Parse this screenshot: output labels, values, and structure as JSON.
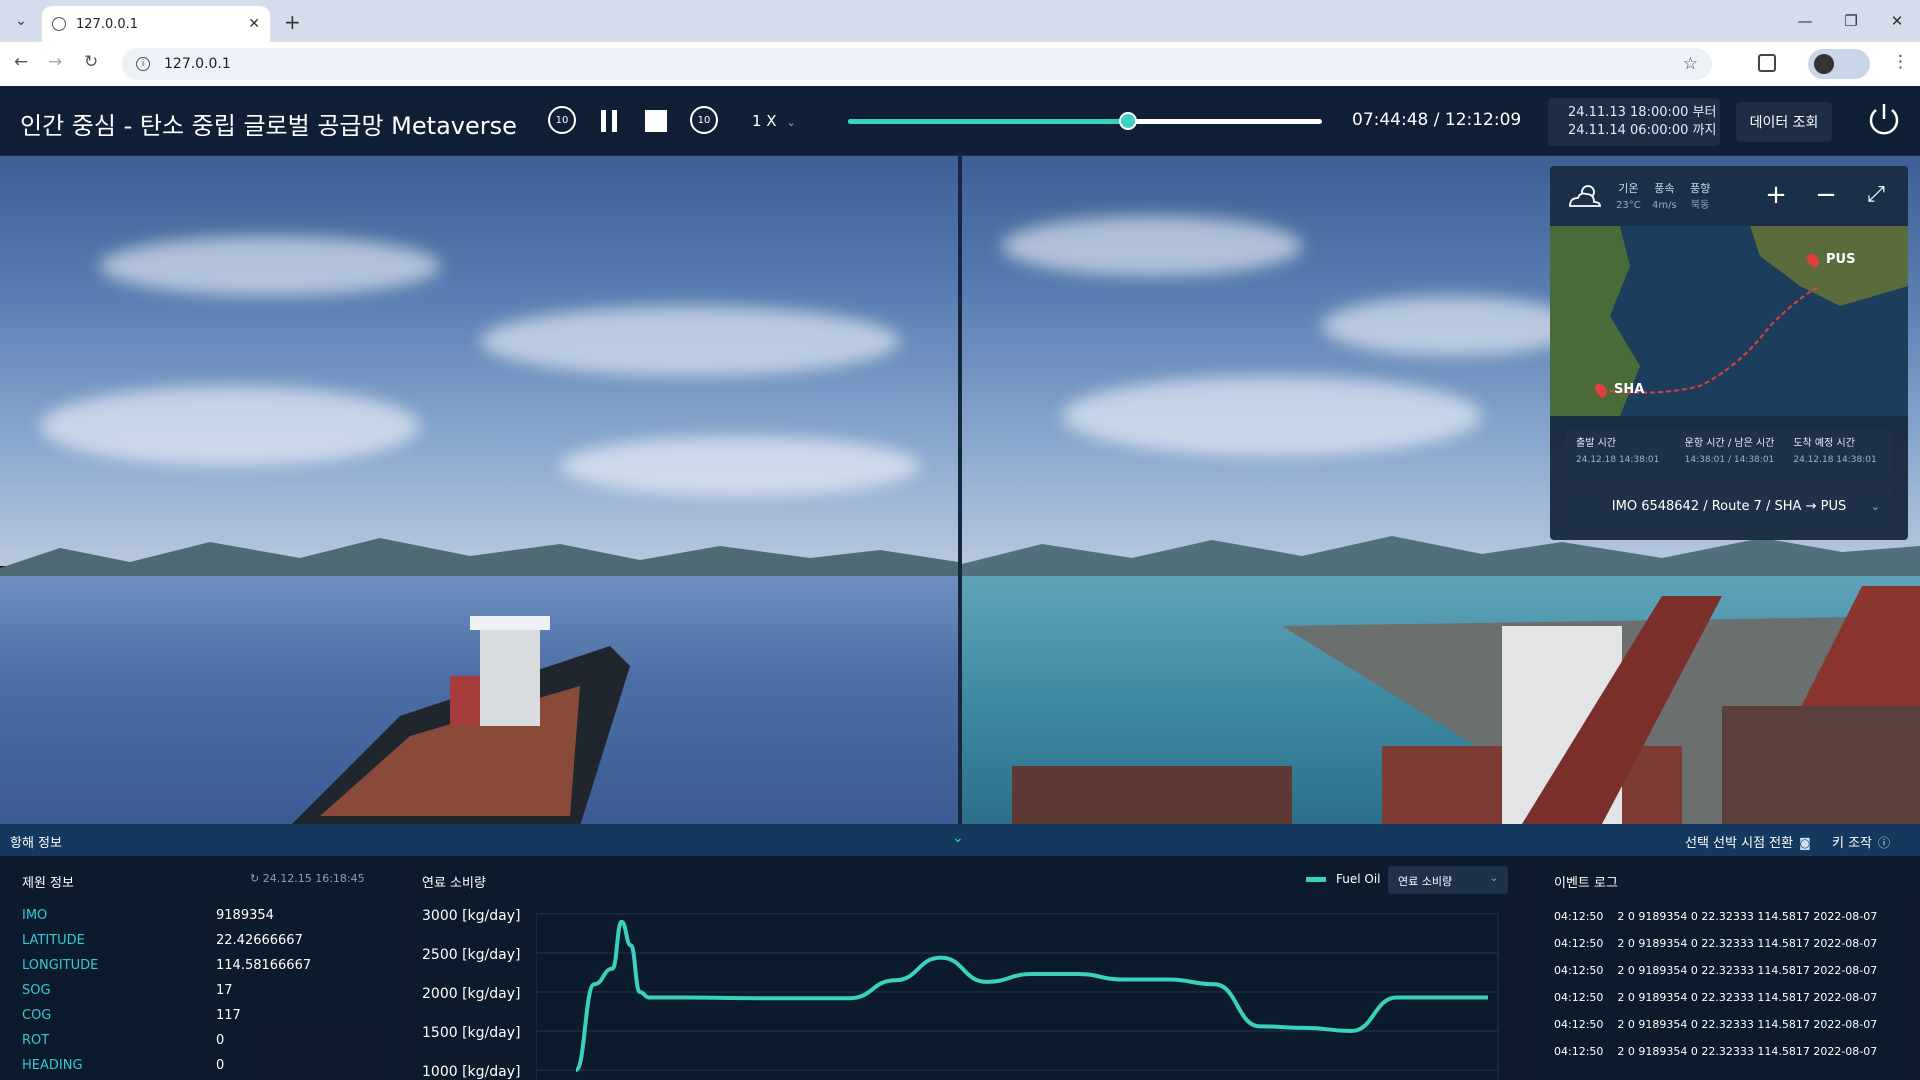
{
  "browser": {
    "tab_title": "127.0.0.1",
    "address": "127.0.0.1"
  },
  "app": {
    "title": "인간 중심 - 탄소 중립 글로벌 공급망 Metaverse",
    "speed": "1 X",
    "rewind_label": "10",
    "forward_label": "10",
    "timecode": "07:44:48 / 12:12:09",
    "progress_fraction": 0.59,
    "date_from": "24.11.13 18:00:00 부터",
    "date_to": "24.11.14 06:00:00 까지",
    "data_button": "데이터 조회"
  },
  "minimap": {
    "weather": [
      {
        "label": "기온",
        "value": "23°C"
      },
      {
        "label": "풍속",
        "value": "4m/s"
      },
      {
        "label": "풍향",
        "value": "북동"
      }
    ],
    "ports": {
      "origin": "SHA",
      "destination": "PUS"
    },
    "info": [
      {
        "label": "출발 시간",
        "value": "24.12.18 14:38:01"
      },
      {
        "label": "운항 시간 / 남은 시간",
        "value": "14:38:01 / 14:38:01"
      },
      {
        "label": "도착 예정 시간",
        "value": "24.12.18 14:38:01"
      }
    ],
    "route": "IMO 6548642 / Route 7 / SHA → PUS"
  },
  "navbar": {
    "label": "항해 정보",
    "switch_view": "선택 선박 시점 전환",
    "key_control": "키 조작"
  },
  "specs": {
    "title": "제원 정보",
    "timestamp": "24.12.15 16:18:45",
    "rows": [
      {
        "key": "IMO",
        "value": "9189354"
      },
      {
        "key": "LATITUDE",
        "value": "22.42666667"
      },
      {
        "key": "LONGITUDE",
        "value": "114.58166667"
      },
      {
        "key": "SOG",
        "value": "17"
      },
      {
        "key": "COG",
        "value": "117"
      },
      {
        "key": "ROT",
        "value": "0"
      },
      {
        "key": "HEADING",
        "value": "0"
      }
    ]
  },
  "fuel": {
    "title": "연료 소비량",
    "legend": "Fuel Oil",
    "select": "연료 소비량",
    "y_ticks": [
      "3000 [kg/day]",
      "2500 [kg/day]",
      "2000 [kg/day]",
      "1500 [kg/day]",
      "1000 [kg/day]"
    ]
  },
  "chart_data": {
    "type": "line",
    "title": "연료 소비량",
    "ylabel": "",
    "ylim": [
      1000,
      3000
    ],
    "series": [
      {
        "name": "Fuel Oil",
        "x": [
          0,
          2,
          4,
          5,
          6,
          7,
          8,
          10,
          12,
          20,
          30,
          35,
          40,
          45,
          50,
          55,
          60,
          65,
          70,
          75,
          80,
          85,
          90,
          95,
          100
        ],
        "values": [
          1000,
          2100,
          2300,
          2900,
          2600,
          2000,
          1930,
          1930,
          1930,
          1920,
          1920,
          2150,
          2440,
          2130,
          2230,
          2230,
          2160,
          2160,
          2100,
          1560,
          1540,
          1500,
          1930,
          1930,
          1930
        ]
      }
    ],
    "color": "#3ad1c2"
  },
  "events": {
    "title": "이벤트 로그",
    "rows": [
      {
        "time": "04:12:50",
        "text": "2 0 9189354 0 22.32333 114.5817 2022-08-07"
      },
      {
        "time": "04:12:50",
        "text": "2 0 9189354 0 22.32333 114.5817 2022-08-07"
      },
      {
        "time": "04:12:50",
        "text": "2 0 9189354 0 22.32333 114.5817 2022-08-07"
      },
      {
        "time": "04:12:50",
        "text": "2 0 9189354 0 22.32333 114.5817 2022-08-07"
      },
      {
        "time": "04:12:50",
        "text": "2 0 9189354 0 22.32333 114.5817 2022-08-07"
      },
      {
        "time": "04:12:50",
        "text": "2 0 9189354 0 22.32333 114.5817 2022-08-07"
      }
    ]
  }
}
